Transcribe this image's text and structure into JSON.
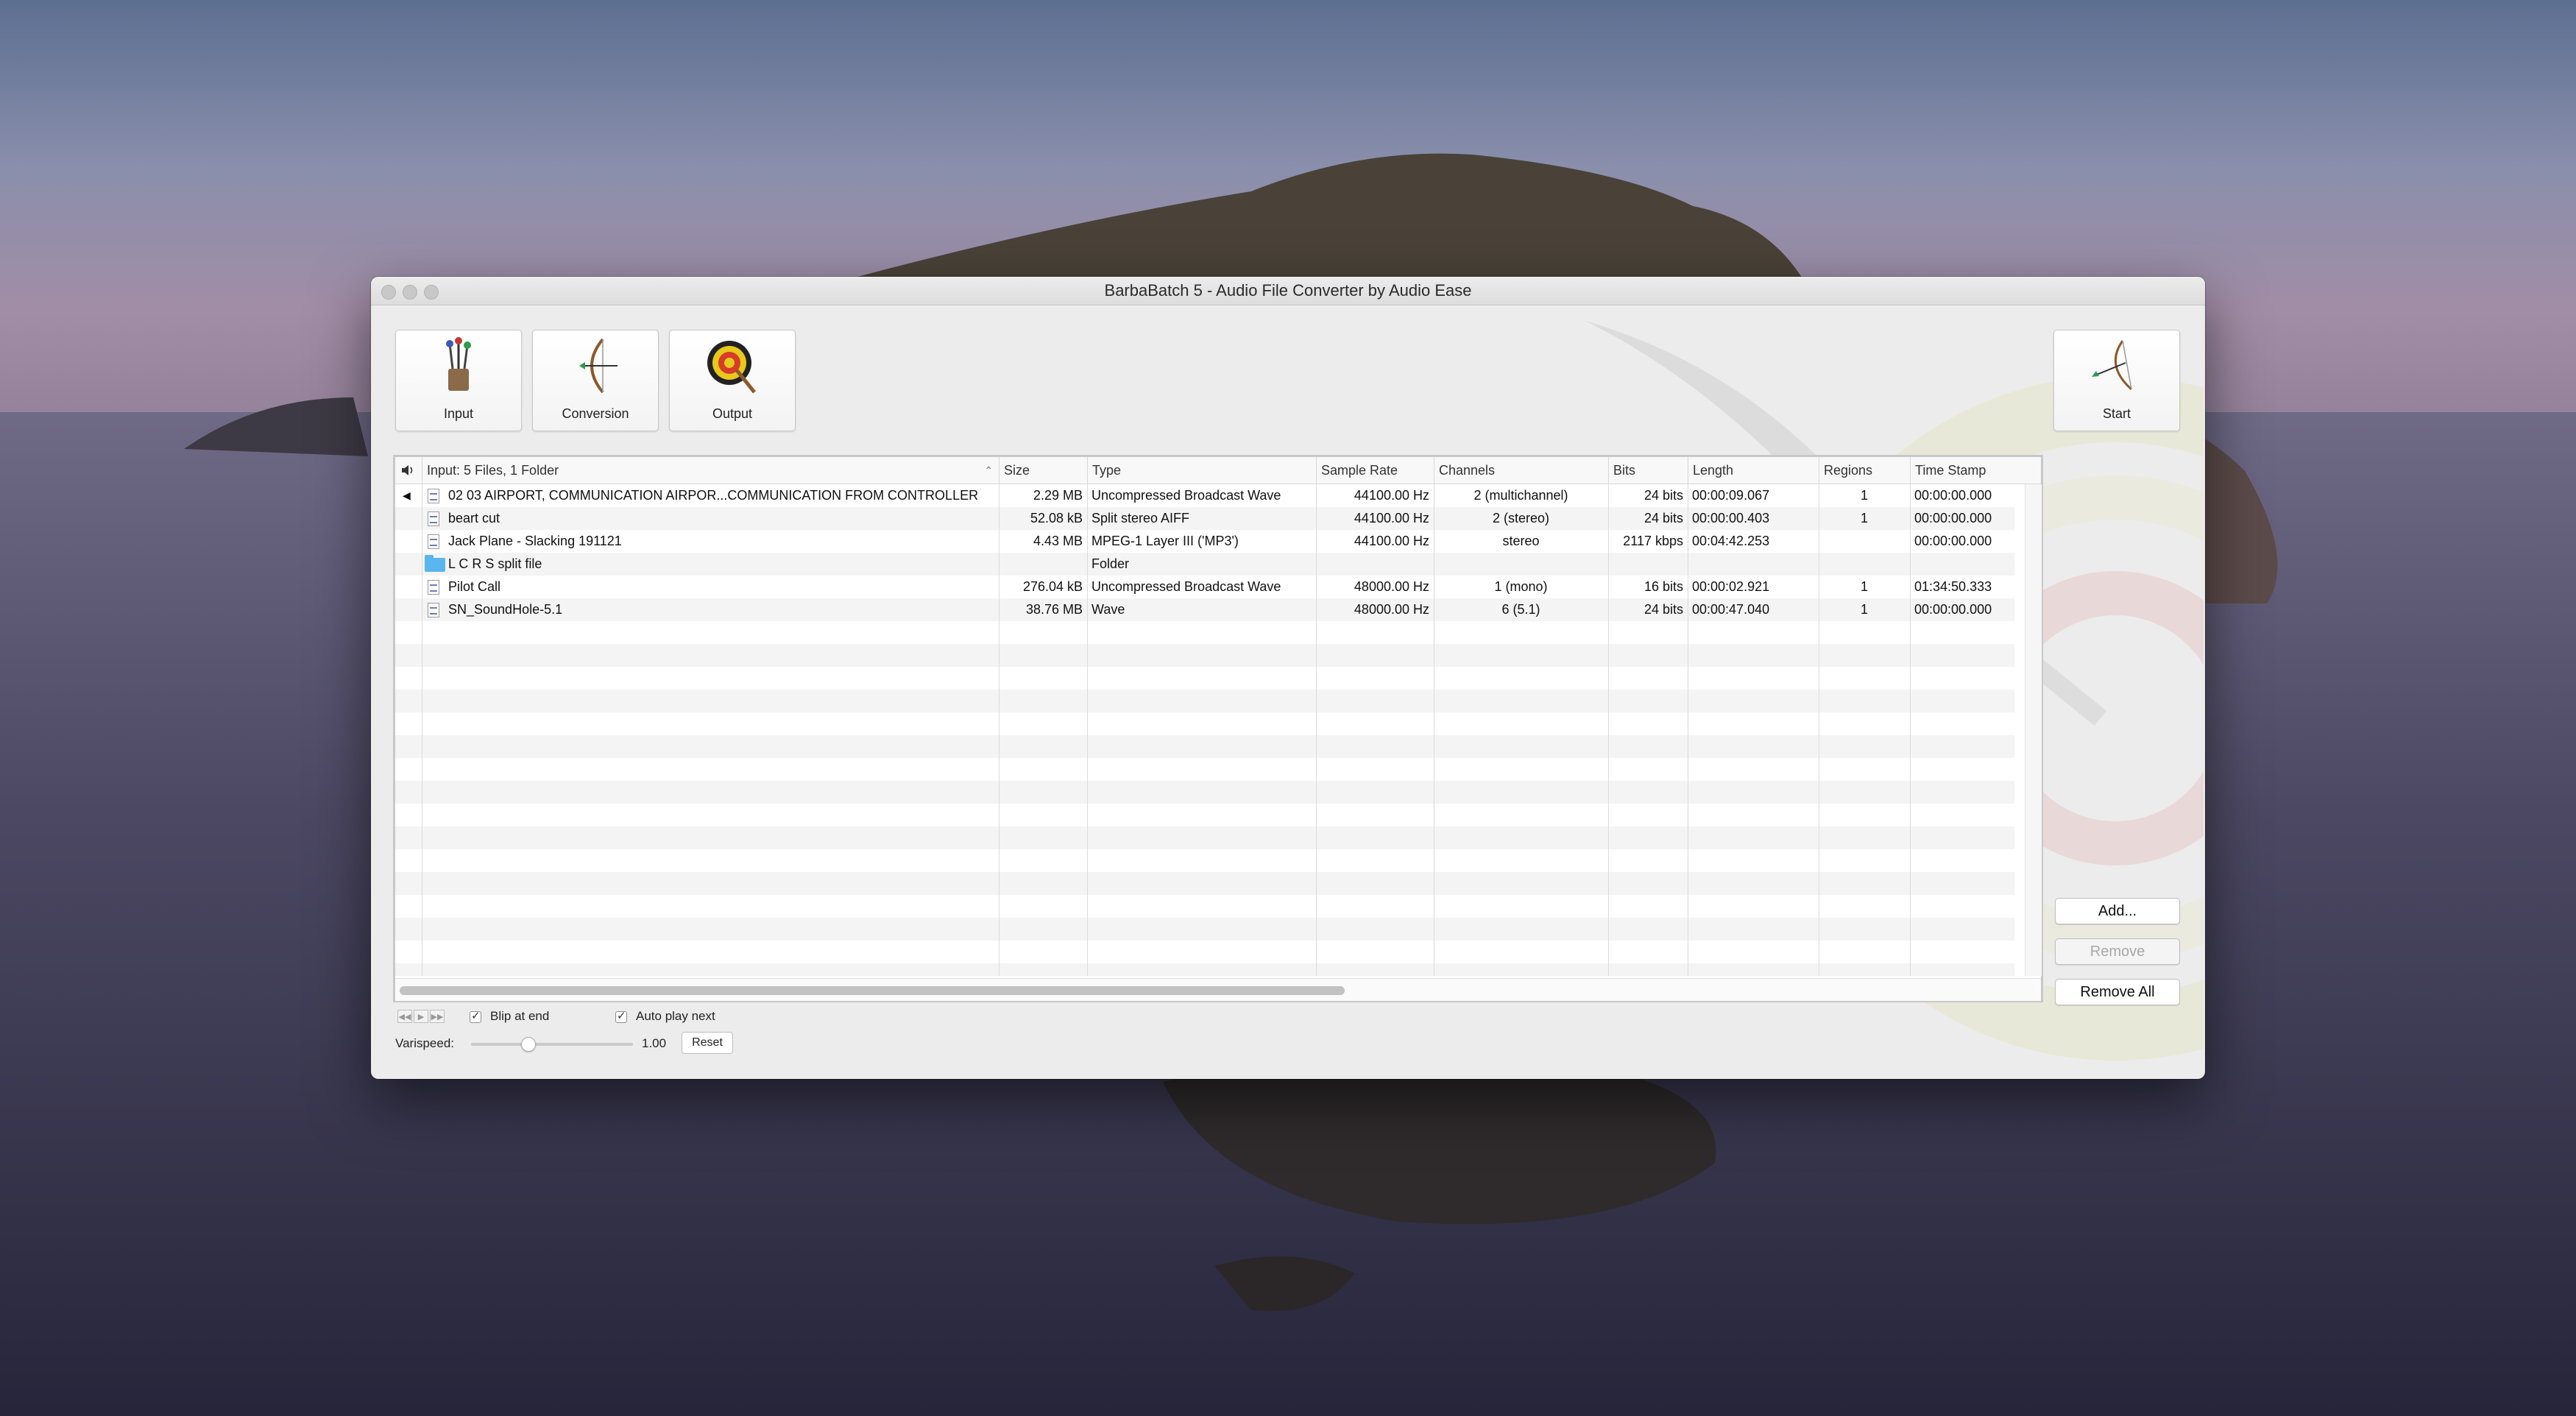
{
  "window": {
    "title": "BarbaBatch 5 - Audio File Converter by Audio Ease"
  },
  "toolbar": {
    "input_label": "Input",
    "conversion_label": "Conversion",
    "output_label": "Output",
    "start_label": "Start"
  },
  "table": {
    "headers": {
      "name": "Input: 5 Files, 1 Folder",
      "size": "Size",
      "type": "Type",
      "sample_rate": "Sample Rate",
      "channels": "Channels",
      "bits": "Bits",
      "length": "Length",
      "regions": "Regions",
      "timestamp": "Time Stamp"
    },
    "rows": [
      {
        "name": "02 03 AIRPORT, COMMUNICATION AIRPOR...COMMUNICATION FROM CONTROLLER",
        "size": "2.29 MB",
        "type": "Uncompressed Broadcast Wave",
        "sample_rate": "44100.00 Hz",
        "channels": "2 (multichannel)",
        "bits": "24 bits",
        "length": "00:00:09.067",
        "regions": "1",
        "timestamp": "00:00:00.000"
      },
      {
        "name": "beart cut",
        "size": "52.08 kB",
        "type": "Split stereo AIFF",
        "sample_rate": "44100.00 Hz",
        "channels": "2 (stereo)",
        "bits": "24 bits",
        "length": "00:00:00.403",
        "regions": "1",
        "timestamp": "00:00:00.000"
      },
      {
        "name": "Jack Plane - Slacking 191121",
        "size": "4.43 MB",
        "type": "MPEG-1 Layer III ('MP3')",
        "sample_rate": "44100.00 Hz",
        "channels": "stereo",
        "bits": "2117 kbps",
        "length": "00:04:42.253",
        "regions": "",
        "timestamp": "00:00:00.000"
      },
      {
        "name": "L C R S split file",
        "size": "",
        "type": "Folder",
        "sample_rate": "",
        "channels": "",
        "bits": "",
        "length": "",
        "regions": "",
        "timestamp": ""
      },
      {
        "name": "Pilot Call",
        "size": "276.04 kB",
        "type": "Uncompressed Broadcast Wave",
        "sample_rate": "48000.00 Hz",
        "channels": "1 (mono)",
        "bits": "16 bits",
        "length": "00:00:02.921",
        "regions": "1",
        "timestamp": "01:34:50.333"
      },
      {
        "name": "SN_SoundHole-5.1",
        "size": "38.76 MB",
        "type": "Wave",
        "sample_rate": "48000.00 Hz",
        "channels": "6 (5.1)",
        "bits": "24 bits",
        "length": "00:00:47.040",
        "regions": "1",
        "timestamp": "00:00:00.000"
      }
    ],
    "row_icons": [
      "file-icon",
      "file-icon",
      "file-icon",
      "folder-icon",
      "file-icon",
      "file-icon"
    ]
  },
  "sidebar": {
    "add_label": "Add...",
    "remove_label": "Remove",
    "remove_all_label": "Remove All"
  },
  "playback": {
    "blip_label": "Blip at end",
    "blip_checked": true,
    "autoplay_label": "Auto play next",
    "autoplay_checked": true,
    "varispeed_label": "Varispeed:",
    "varispeed_value": "1.00",
    "reset_label": "Reset"
  },
  "colors": {
    "folder": "#59b6ef",
    "window_bg": "#ececec"
  }
}
